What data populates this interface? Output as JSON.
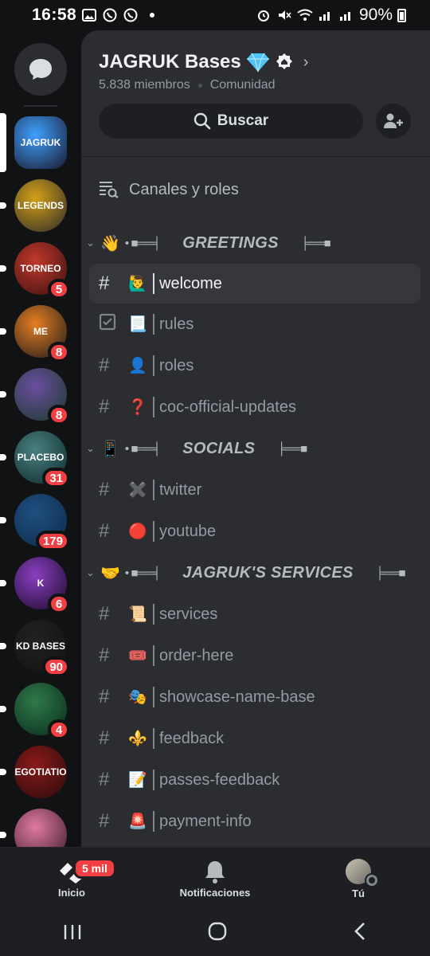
{
  "status_bar": {
    "time": "16:58",
    "battery": "90%"
  },
  "guild": {
    "name": "JAGRUK Bases",
    "members": "5.838 miembros",
    "type": "Comunidad",
    "search_label": "Buscar",
    "channels_roles_label": "Canales y roles"
  },
  "servers": [
    {
      "label": "JAGRUK",
      "badge": "",
      "colors": [
        "#1a1a2e",
        "#3fa0ff"
      ]
    },
    {
      "label": "LEGENDS",
      "badge": "",
      "colors": [
        "#2a2a2a",
        "#d4a017"
      ]
    },
    {
      "label": "TORNEO",
      "badge": "5",
      "colors": [
        "#3a1010",
        "#c0392b"
      ]
    },
    {
      "label": "ME",
      "badge": "8",
      "colors": [
        "#1a1a1a",
        "#e67e22"
      ]
    },
    {
      "label": "",
      "badge": "8",
      "colors": [
        "#1a3a2a",
        "#6a4ea0"
      ]
    },
    {
      "label": "PLACEBO",
      "badge": "31",
      "colors": [
        "#0d2a2a",
        "#4a8080"
      ]
    },
    {
      "label": "",
      "badge": "179",
      "colors": [
        "#0f2a4a",
        "#1e5080"
      ]
    },
    {
      "label": "K",
      "badge": "6",
      "colors": [
        "#1a0a2a",
        "#8a3fc0"
      ]
    },
    {
      "label": "KD BASES",
      "badge": "90",
      "colors": [
        "#111",
        "#222"
      ]
    },
    {
      "label": "",
      "badge": "4",
      "colors": [
        "#0a2a1a",
        "#2e7a4a"
      ]
    },
    {
      "label": "NEGOTIATION",
      "badge": "",
      "colors": [
        "#2a0a0a",
        "#8a1a1a"
      ]
    },
    {
      "label": "",
      "badge": "",
      "colors": [
        "#3a1a2a",
        "#e07aa0"
      ]
    }
  ],
  "categories": [
    {
      "emoji": "👋",
      "name": "GREETINGS",
      "channels": [
        {
          "emoji": "🙋‍♂️",
          "name": "welcome",
          "icon": "hash",
          "selected": true
        },
        {
          "emoji": "📃",
          "name": "rules",
          "icon": "rules",
          "selected": false
        },
        {
          "emoji": "👤",
          "name": "roles",
          "icon": "hash",
          "selected": false
        },
        {
          "emoji": "❓",
          "name": "coc-official-updates",
          "icon": "hash",
          "selected": false
        }
      ]
    },
    {
      "emoji": "📱",
      "name": "SOCIALS",
      "channels": [
        {
          "emoji": "✖️",
          "name": "twitter",
          "icon": "hash",
          "selected": false
        },
        {
          "emoji": "🔴",
          "name": "youtube",
          "icon": "hash",
          "selected": false
        }
      ]
    },
    {
      "emoji": "🤝",
      "name": "JAGRUK'S SERVICES",
      "channels": [
        {
          "emoji": "📜",
          "name": "services",
          "icon": "hash",
          "selected": false
        },
        {
          "emoji": "🎟️",
          "name": "order-here",
          "icon": "hash",
          "selected": false
        },
        {
          "emoji": "🎭",
          "name": "showcase-name-base",
          "icon": "hash",
          "selected": false
        },
        {
          "emoji": "⚜️",
          "name": "feedback",
          "icon": "hash",
          "selected": false
        },
        {
          "emoji": "📝",
          "name": "passes-feedback",
          "icon": "hash",
          "selected": false
        },
        {
          "emoji": "🚨",
          "name": "payment-info",
          "icon": "hash",
          "selected": false
        }
      ]
    }
  ],
  "bottom_nav": {
    "home_label": "Inicio",
    "home_badge": "5 mil",
    "notifications_label": "Notificaciones",
    "you_label": "Tú"
  },
  "colors": {
    "accent_red": "#f23f43",
    "panel": "#2b2d31",
    "rail": "#111214"
  }
}
